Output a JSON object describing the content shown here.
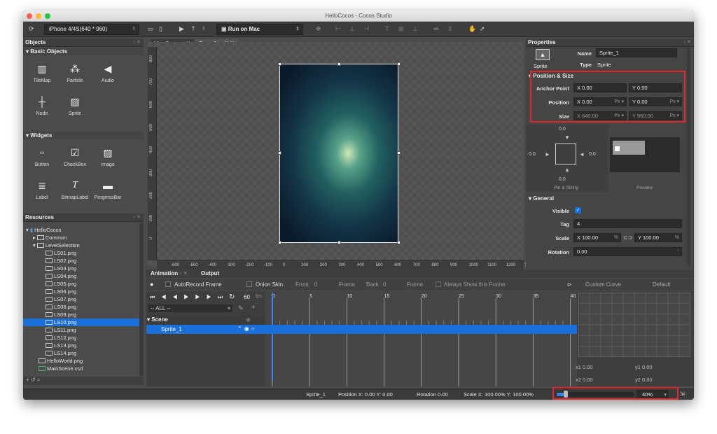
{
  "window": {
    "title": "HelloCocos - Cocos Studio"
  },
  "toolbar": {
    "device": "iPhone 4/4S(640 * 960)",
    "run_target": "Run on Mac"
  },
  "objects": {
    "title": "Objects",
    "basic_section": "Basic Objects",
    "basic_items": [
      "TileMap",
      "Particle",
      "Audio",
      "Node",
      "Sprite"
    ],
    "widgets_section": "Widgets",
    "widget_items": [
      "Button",
      "CheckBox",
      "Image",
      "Label",
      "BitmapLabel",
      "ProgressBar"
    ]
  },
  "resources": {
    "title": "Resources",
    "items": [
      "HelloCocos",
      "Common",
      "LevelSelection",
      "LS01.png",
      "LS02.png",
      "LS03.png",
      "LS04.png",
      "LS05.png",
      "LS06.png",
      "LS07.png",
      "LS08.png",
      "LS09.png",
      "LS10.png",
      "LS11.png",
      "LS12.png",
      "LS13.png",
      "LS14.png",
      "HelloWorld.png",
      "MainScene.csd"
    ],
    "selected": "LS10.png"
  },
  "editor": {
    "tabs": [
      "MainScene.c",
      "Scene1.csd*"
    ],
    "ruler_x": [
      "-600",
      "-500",
      "-400",
      "-300",
      "-200",
      "-100",
      "0",
      "100",
      "200",
      "300",
      "400",
      "500",
      "600",
      "700",
      "800",
      "900",
      "1000",
      "1100",
      "1200",
      "130"
    ],
    "ruler_y": [
      "800",
      "700",
      "600",
      "500",
      "400",
      "300",
      "200",
      "100",
      "0"
    ]
  },
  "properties": {
    "title": "Properties",
    "type_caption": "Sprite",
    "name_label": "Name",
    "name_value": "Sprite_1",
    "type_label": "Type",
    "type_value": "Sprite",
    "pos_section": "Position & Size",
    "anchor_label": "Anchor Point",
    "anchor_x": "X  0.00",
    "anchor_y": "Y  0.00",
    "position_label": "Position",
    "pos_x": "X  0.00",
    "pos_y": "Y  0.00",
    "unit": "Px",
    "size_label": "Size",
    "size_w": "X  640.00",
    "size_h": "Y  960.00",
    "pin_top": "0.0",
    "pin_left": "0.0",
    "pin_right": "0.0",
    "pin_bottom": "0.0",
    "pin_caption": "Pin & Sizing",
    "preview_caption": "Preview",
    "general_section": "General",
    "visible_label": "Visible",
    "tag_label": "Tag",
    "tag_value": "4",
    "scale_label": "Scale",
    "scale_x": "X  100.00",
    "scale_y": "Y  100.00",
    "pct": "%",
    "rotation_label": "Rotation",
    "rotation_value": "0.00"
  },
  "animation": {
    "tabs": [
      "Animation",
      "Output"
    ],
    "autorecord": "AutoRecord Frame",
    "onion": "Onion Skin",
    "front": "Front",
    "front_val": "0",
    "frame1": "Frame",
    "back": "Back",
    "back_val": "0",
    "frame2": "Frame",
    "always": "Always Show this Frame",
    "fps": "60",
    "fps_unit": "fps",
    "filter": "-- ALL --",
    "frame_ticks": [
      "0",
      "5",
      "10",
      "15",
      "20",
      "25",
      "30",
      "35",
      "40"
    ],
    "scene_label": "Scene",
    "sprite_label": "Sprite_1",
    "curve_label": "Custom Curve",
    "default_label": "Default",
    "x1": "x1  0.00",
    "y1": "y1  0.00",
    "x2": "x2  0.00",
    "y2": "y2  0.00"
  },
  "status": {
    "name": "Sprite_1",
    "position": "Position X: 0.00   Y: 0.00",
    "rotation": "Rotation 0.00",
    "scale": "Scale X: 100.00%   Y: 100.00%",
    "zoom": "40%"
  },
  "colors": {
    "accent": "#1b6fd8",
    "highlight": "#e3262a"
  }
}
